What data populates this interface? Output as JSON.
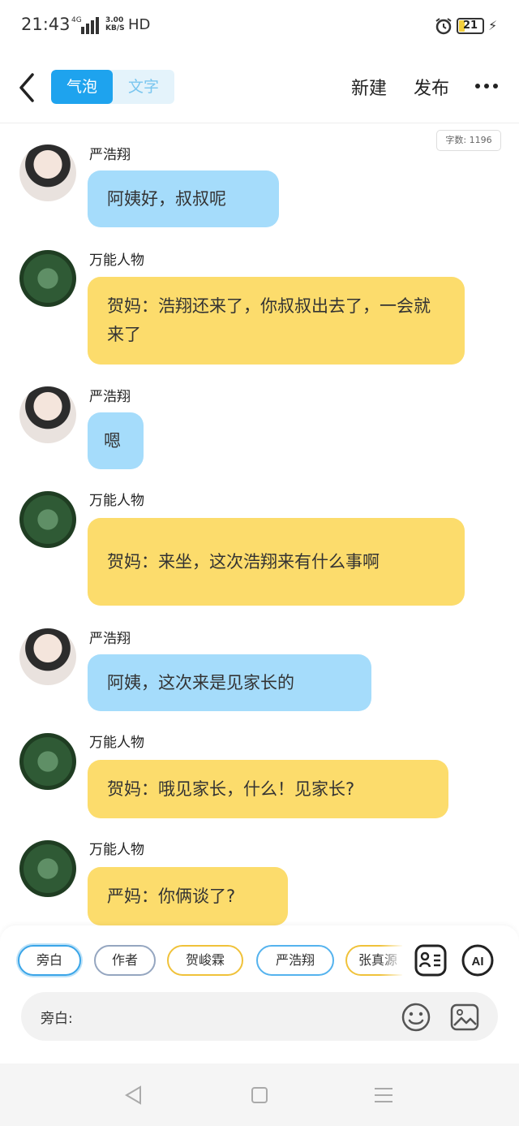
{
  "status_bar": {
    "time": "21:43",
    "network": "4G",
    "speed": "3.00\nKB/S",
    "hd": "HD",
    "battery": "21"
  },
  "nav": {
    "toggle_bubble": "气泡",
    "toggle_text": "文字",
    "new_label": "新建",
    "publish_label": "发布"
  },
  "word_count": "字数: 1196",
  "messages": [
    {
      "sender": "严浩翔",
      "avatar": "boy",
      "color": "blue",
      "text": "阿姨好，叔叔呢"
    },
    {
      "sender": "万能人物",
      "avatar": "tree",
      "color": "yellow",
      "text": "贺妈：浩翔还来了，你叔叔出去了，一会就来了"
    },
    {
      "sender": "严浩翔",
      "avatar": "boy",
      "color": "blue",
      "text": "嗯"
    },
    {
      "sender": "万能人物",
      "avatar": "tree",
      "color": "yellow",
      "text": "贺妈：来坐，这次浩翔来有什么事啊"
    },
    {
      "sender": "严浩翔",
      "avatar": "boy",
      "color": "blue",
      "text": "阿姨，这次来是见家长的"
    },
    {
      "sender": "万能人物",
      "avatar": "tree",
      "color": "yellow",
      "text": "贺妈：哦见家长，什么！见家长?"
    },
    {
      "sender": "万能人物",
      "avatar": "tree",
      "color": "yellow",
      "text": "严妈：你俩谈了?"
    }
  ],
  "role_chips": [
    "旁白",
    "作者",
    "贺峻霖",
    "严浩翔",
    "张真源"
  ],
  "input": {
    "label": "旁白:"
  },
  "icons": {
    "back": "chevron-left-icon",
    "more": "more-dots-icon",
    "roles": "role-card-icon",
    "ai": "ai-icon",
    "emoji": "emoji-icon",
    "image": "image-icon"
  },
  "colors": {
    "accent": "#1ea3ee",
    "bubble_blue": "#a5dcfb",
    "bubble_yellow": "#fcdc6c"
  }
}
